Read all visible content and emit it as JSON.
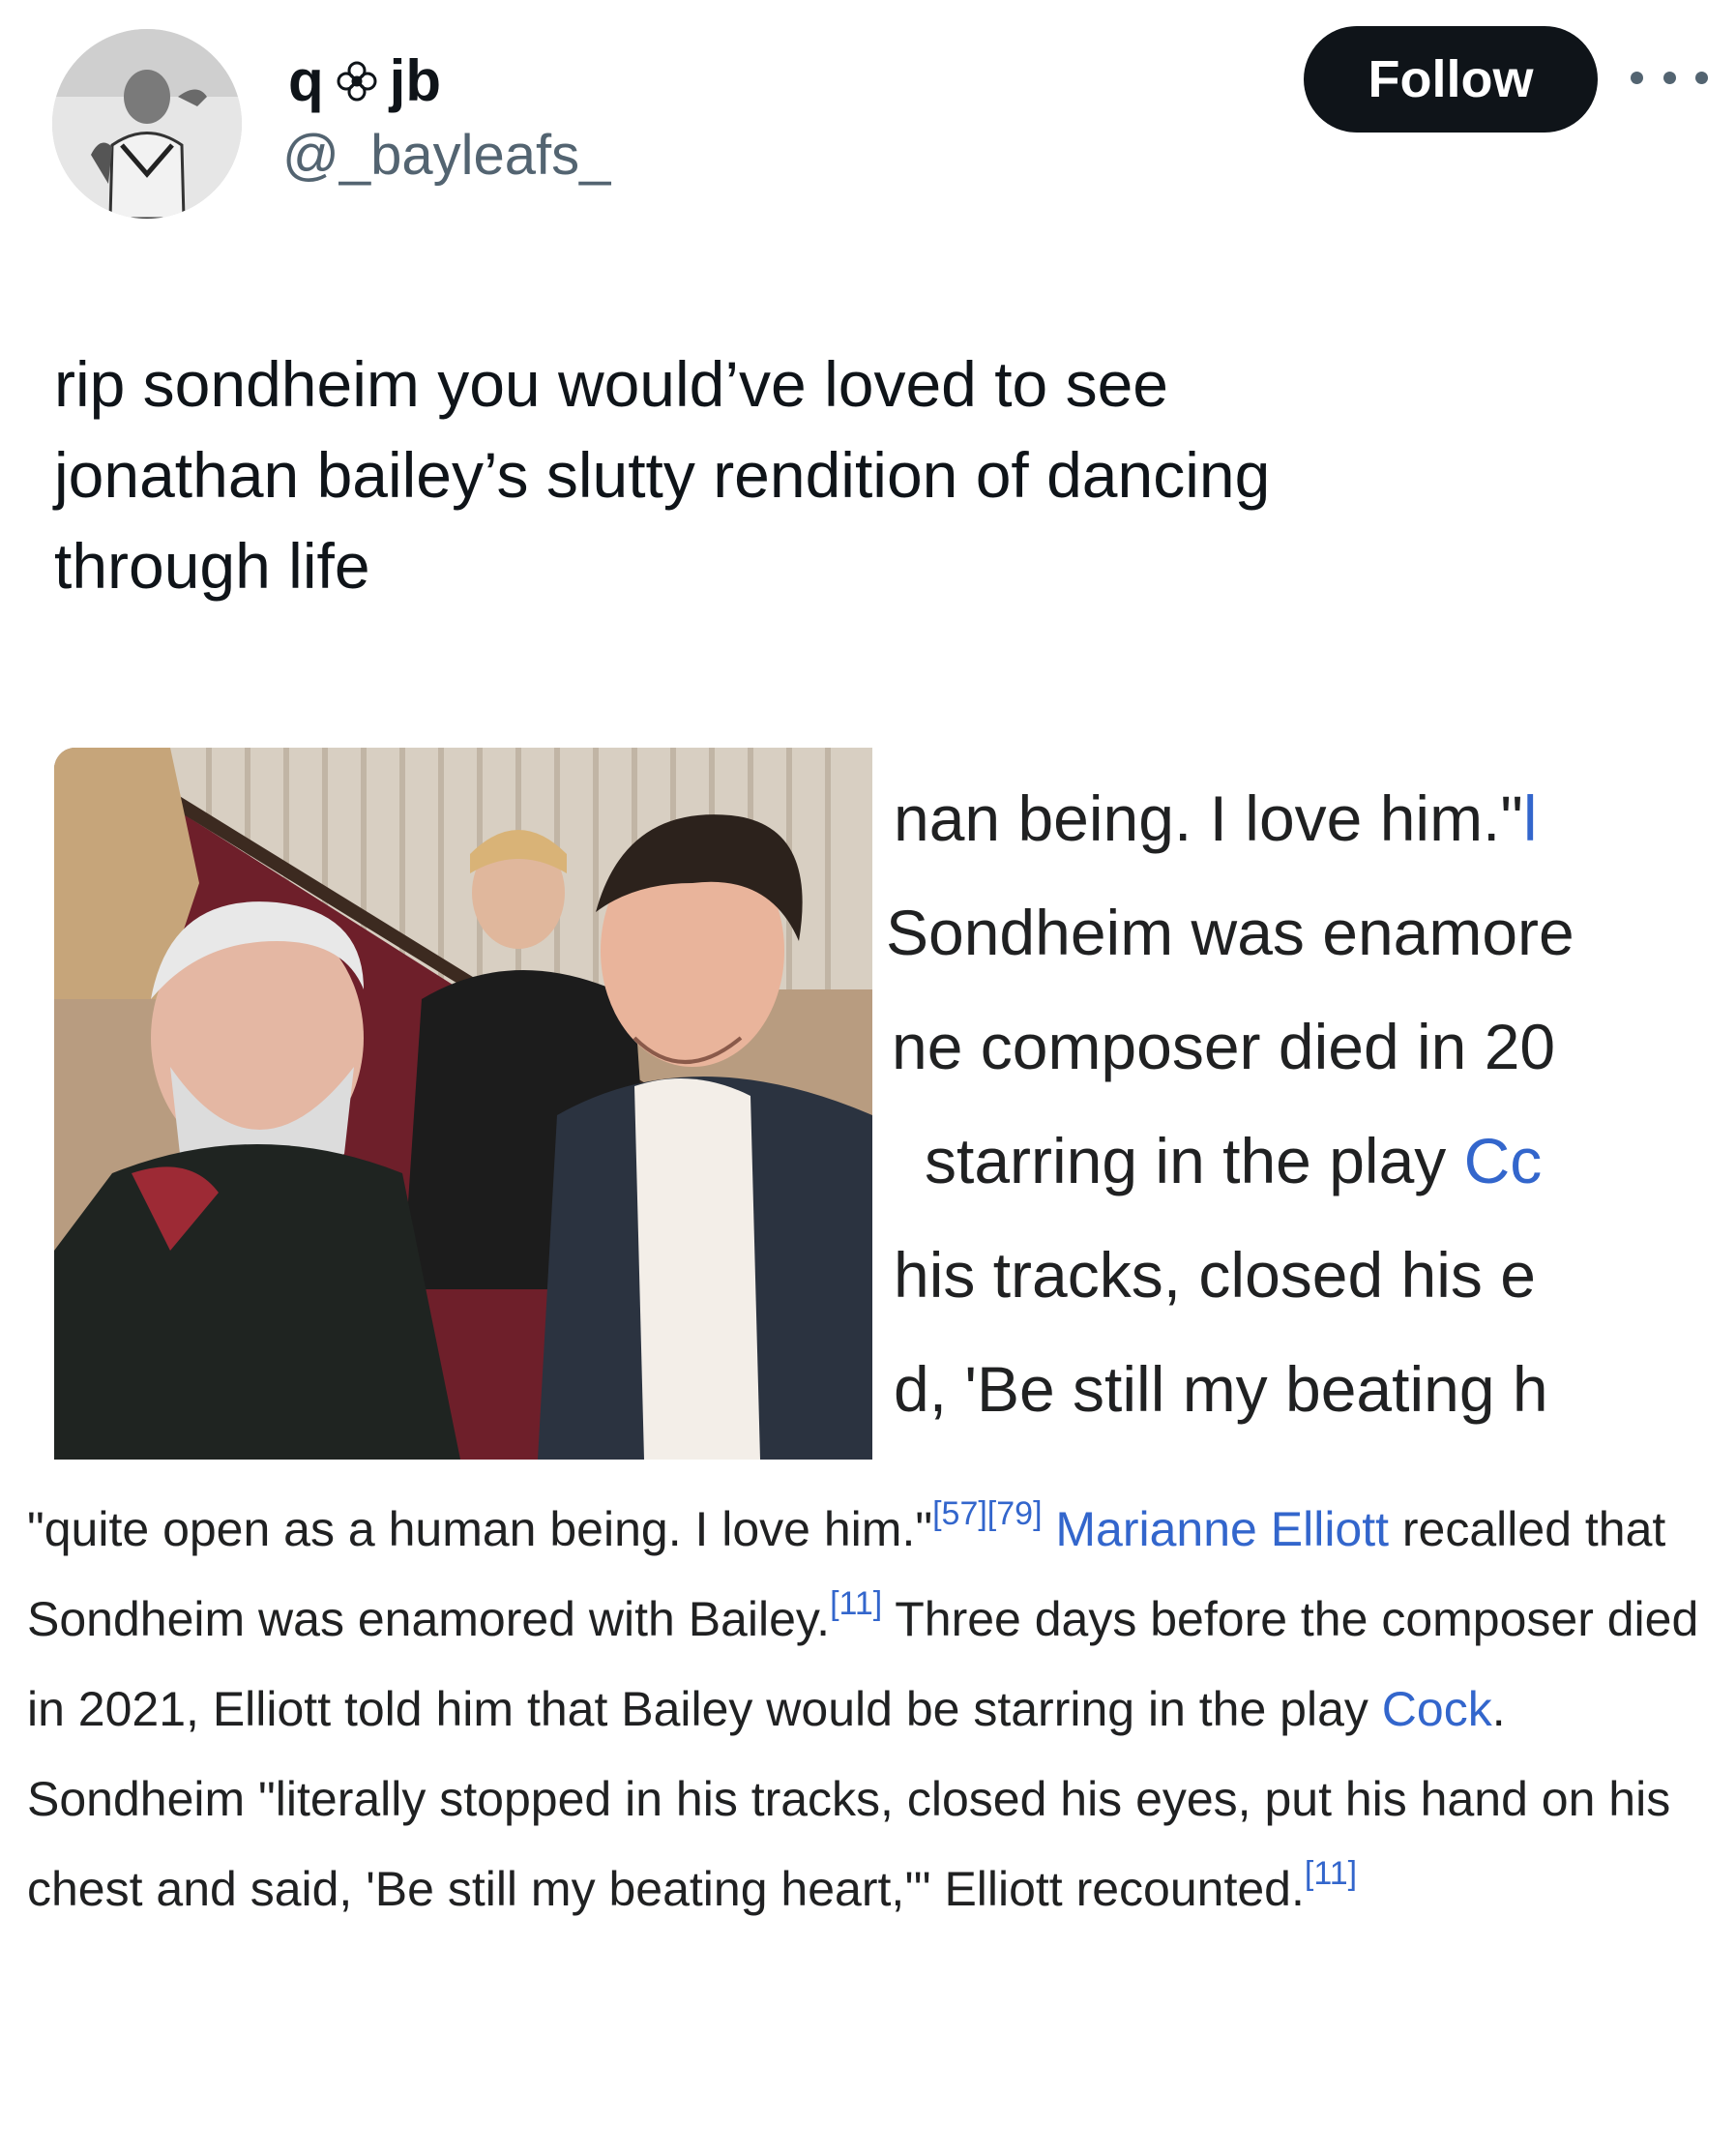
{
  "author": {
    "display_name_start": "q",
    "display_name_end": "jb",
    "name_separator_icon": "flower-icon",
    "handle": "@_bayleafs_"
  },
  "actions": {
    "follow_label": "Follow",
    "more_icon": "more-dots-icon"
  },
  "tweet": {
    "text": "rip sondheim you would’ve loved to see\njonathan bailey’s slutty rendition of dancing\nthrough life"
  },
  "media": {
    "photo": {
      "description_icon": "photo-image"
    },
    "cropped_lines": [
      {
        "text": "nan being. I love him.\"",
        "suffix": "l"
      },
      {
        "text": "Sondheim was enamore"
      },
      {
        "text": "ne composer died in 20"
      },
      {
        "text": "starring in the play ",
        "link": "Cc"
      },
      {
        "text": "his tracks, closed his e"
      },
      {
        "text": "d, 'Be still my beating h"
      }
    ],
    "paragraph": {
      "p1": "\"quite open as a human being. I love him.\"",
      "ref1": "[57][79]",
      "link1": " Marianne Elliott",
      "p2": " recalled that Sondheim was enamored with Bailey.",
      "ref2": "[11]",
      "p3": " Three days before the composer died in 2021, Elliott told him that Bailey would be starring in the play ",
      "link2": "Cock",
      "p4": ". Sondheim \"literally stopped in his tracks, closed his eyes, put his hand on his chest and said, 'Be still my beating heart,'\" Elliott recounted.",
      "ref3": "[11]"
    }
  },
  "colors": {
    "text": "#0f1419",
    "secondary": "#536471",
    "follow_bg": "#0f1419",
    "wiki_link": "#3366cc",
    "wiki_text": "#202122"
  }
}
